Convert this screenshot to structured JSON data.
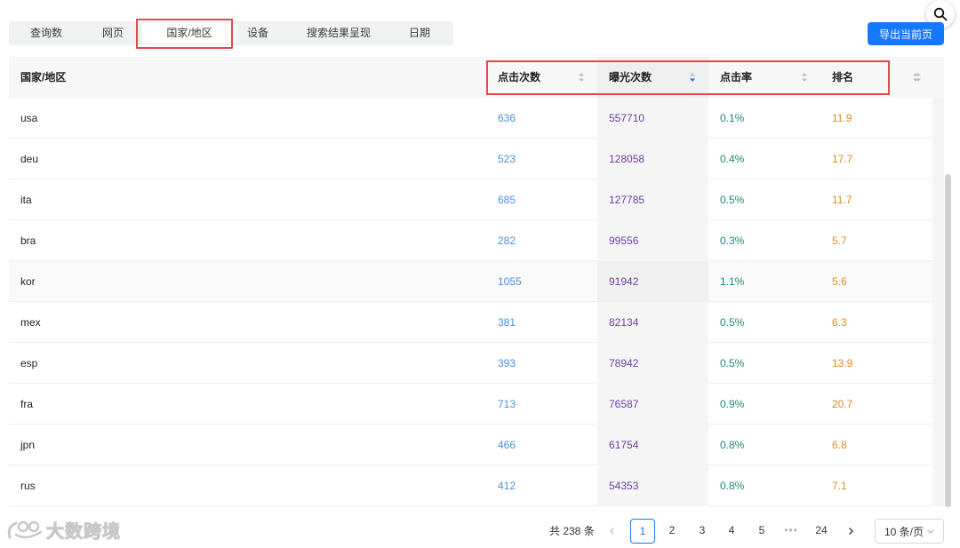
{
  "tabs": [
    {
      "label": "查询数",
      "active": false
    },
    {
      "label": "网页",
      "active": false
    },
    {
      "label": "国家/地区",
      "active": true
    },
    {
      "label": "设备",
      "active": false
    },
    {
      "label": "搜索结果呈现",
      "active": false
    },
    {
      "label": "日期",
      "active": false
    }
  ],
  "export_label": "导出当前页",
  "search_icon": "search-icon",
  "table": {
    "columns": [
      "国家/地区",
      "点击次数",
      "曝光次数",
      "点击率",
      "排名"
    ],
    "sorted_column": "曝光次数",
    "sort_direction": "desc",
    "rows": [
      {
        "country": "usa",
        "clicks": "636",
        "impressions": "557710",
        "ctr": "0.1%",
        "rank": "11.9"
      },
      {
        "country": "deu",
        "clicks": "523",
        "impressions": "128058",
        "ctr": "0.4%",
        "rank": "17.7"
      },
      {
        "country": "ita",
        "clicks": "685",
        "impressions": "127785",
        "ctr": "0.5%",
        "rank": "11.7"
      },
      {
        "country": "bra",
        "clicks": "282",
        "impressions": "99556",
        "ctr": "0.3%",
        "rank": "5.7"
      },
      {
        "country": "kor",
        "clicks": "1055",
        "impressions": "91942",
        "ctr": "1.1%",
        "rank": "5.6"
      },
      {
        "country": "mex",
        "clicks": "381",
        "impressions": "82134",
        "ctr": "0.5%",
        "rank": "6.3"
      },
      {
        "country": "esp",
        "clicks": "393",
        "impressions": "78942",
        "ctr": "0.5%",
        "rank": "13.9"
      },
      {
        "country": "fra",
        "clicks": "713",
        "impressions": "76587",
        "ctr": "0.9%",
        "rank": "20.7"
      },
      {
        "country": "jpn",
        "clicks": "466",
        "impressions": "61754",
        "ctr": "0.8%",
        "rank": "6.8"
      },
      {
        "country": "rus",
        "clicks": "412",
        "impressions": "54353",
        "ctr": "0.8%",
        "rank": "7.1"
      }
    ]
  },
  "pagination": {
    "total_label": "共 238 条",
    "pages": [
      "1",
      "2",
      "3",
      "4",
      "5",
      "•••",
      "24"
    ],
    "current": "1",
    "page_size_label": "10 条/页"
  },
  "watermark": "大数跨境",
  "colors": {
    "accent": "#1677ff",
    "highlight_box": "#e5484d",
    "clicks": "#4a90d9",
    "impressions": "#6b3fa0",
    "ctr": "#1b8a7a",
    "rank": "#e08a1e"
  }
}
